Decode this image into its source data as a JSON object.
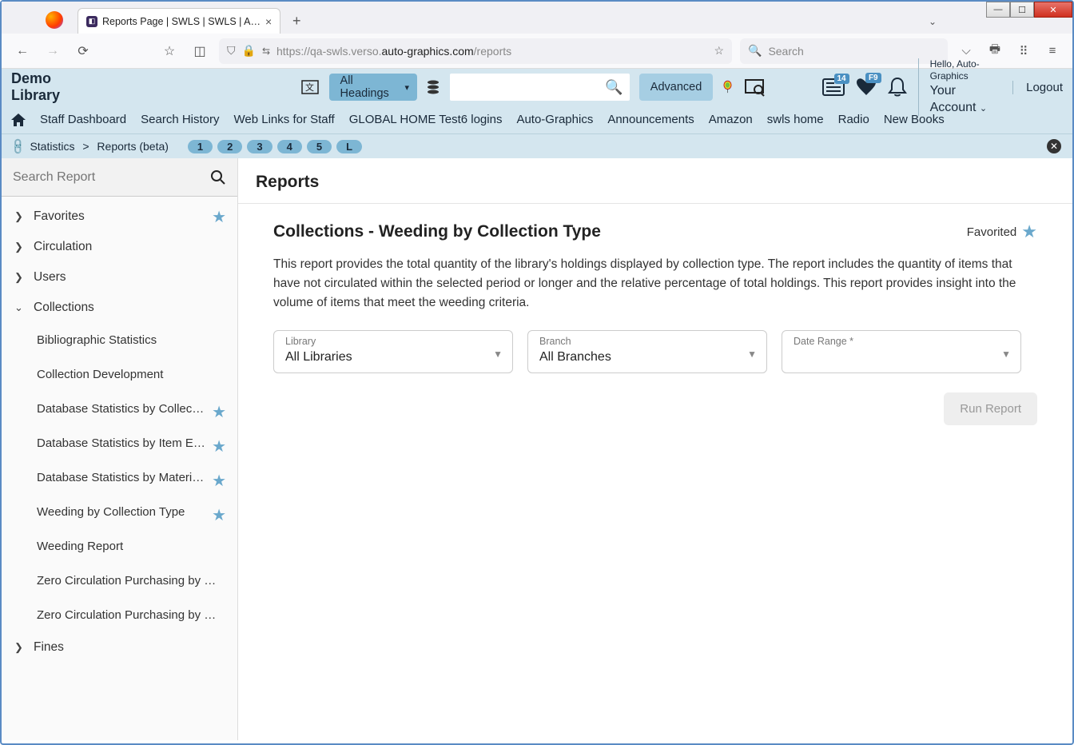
{
  "browser": {
    "tab_title": "Reports Page | SWLS | SWLS | A…",
    "url_prefix": "https://qa-swls.verso.",
    "url_domain": "auto-graphics.com",
    "url_path": "/reports",
    "search_placeholder": "Search"
  },
  "header": {
    "library_name": "Demo Library",
    "headings_dropdown": "All Headings",
    "advanced_label": "Advanced",
    "hello_text": "Hello, Auto-Graphics",
    "account_label": "Your Account",
    "logout_label": "Logout",
    "badge_news": "14",
    "badge_heart": "F9"
  },
  "nav": {
    "items": [
      "Staff Dashboard",
      "Search History",
      "Web Links for Staff",
      "GLOBAL HOME Test6 logins",
      "Auto-Graphics",
      "Announcements",
      "Amazon",
      "swls home",
      "Radio",
      "New Books"
    ]
  },
  "crumb": {
    "stat": "Statistics",
    "reports": "Reports (beta)",
    "pills": [
      "1",
      "2",
      "3",
      "4",
      "5",
      "L"
    ]
  },
  "sidebar": {
    "search_placeholder": "Search Report",
    "categories": [
      {
        "label": "Favorites",
        "expanded": false,
        "star": true
      },
      {
        "label": "Circulation",
        "expanded": false
      },
      {
        "label": "Users",
        "expanded": false
      },
      {
        "label": "Collections",
        "expanded": true,
        "children": [
          {
            "label": "Bibliographic Statistics",
            "star": false
          },
          {
            "label": "Collection Development",
            "star": false
          },
          {
            "label": "Database Statistics by Collection …",
            "star": true
          },
          {
            "label": "Database Statistics by Item Except…",
            "star": true
          },
          {
            "label": "Database Statistics by Material Ty…",
            "star": true
          },
          {
            "label": "Weeding by Collection Type",
            "star": true
          },
          {
            "label": "Weeding Report",
            "star": false
          },
          {
            "label": "Zero Circulation Purchasing by Collect…",
            "star": false
          },
          {
            "label": "Zero Circulation Purchasing by Materi…",
            "star": false
          }
        ]
      },
      {
        "label": "Fines",
        "expanded": false
      }
    ]
  },
  "content": {
    "page_heading": "Reports",
    "report_title": "Collections - Weeding by Collection Type",
    "favorited_label": "Favorited",
    "description": "This report provides the total quantity of the library's holdings displayed by collection type. The report includes the quantity of items that have not circulated within the selected period or longer and the relative percentage of total holdings. This report provides insight into the volume of items that meet the weeding criteria.",
    "filters": {
      "library_label": "Library",
      "library_value": "All Libraries",
      "branch_label": "Branch",
      "branch_value": "All Branches",
      "date_label": "Date Range *",
      "date_value": ""
    },
    "run_label": "Run Report"
  }
}
